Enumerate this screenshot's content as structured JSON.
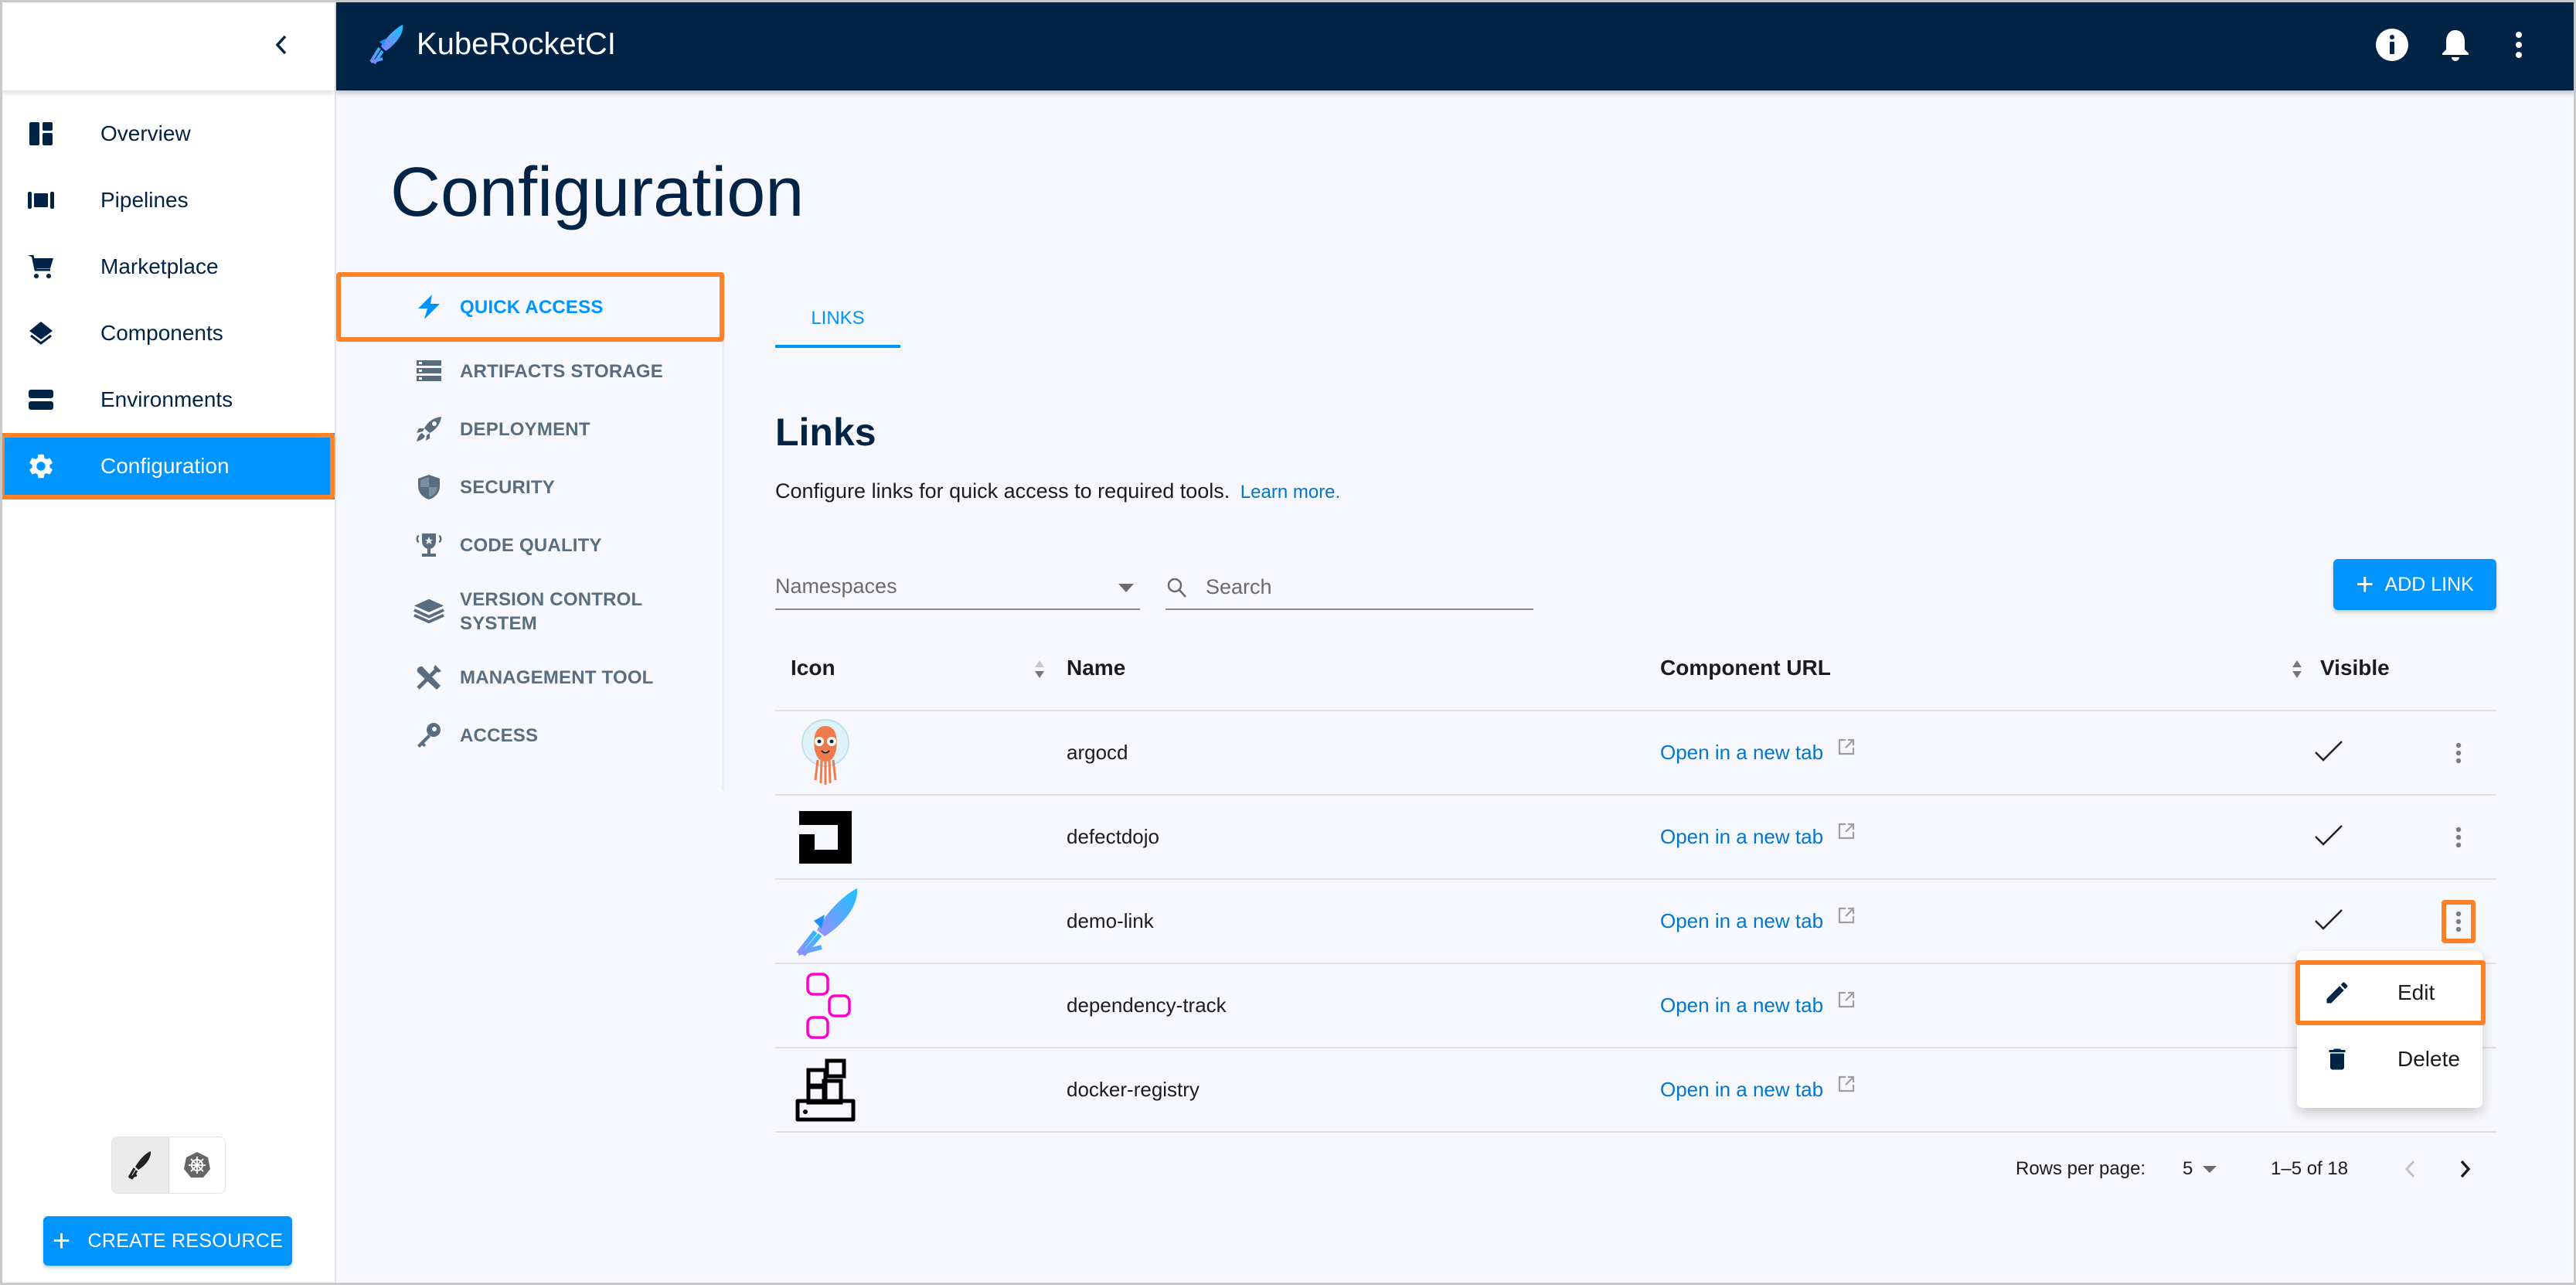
{
  "app": {
    "title": "KubeRocketCI",
    "colors": {
      "header_bg": "#002346",
      "accent": "#0094ff",
      "highlight": "#ff8128",
      "link": "#0077cc",
      "text_dark": "#002346",
      "nav_muted": "#596d80"
    }
  },
  "header": {
    "actions": [
      {
        "name": "info-icon",
        "label": "Info"
      },
      {
        "name": "bell-icon",
        "label": "Notifications"
      },
      {
        "name": "more-vertical-icon",
        "label": "More"
      }
    ]
  },
  "sidebar": {
    "collapse_icon": "chevron-left-icon",
    "items": [
      {
        "label": "Overview",
        "icon": "dashboard-icon",
        "active": false
      },
      {
        "label": "Pipelines",
        "icon": "pipelines-icon",
        "active": false
      },
      {
        "label": "Marketplace",
        "icon": "cart-icon",
        "active": false
      },
      {
        "label": "Components",
        "icon": "layers-icon",
        "active": false
      },
      {
        "label": "Environments",
        "icon": "environments-icon",
        "active": false
      },
      {
        "label": "Configuration",
        "icon": "gear-icon",
        "active": true
      }
    ],
    "mode_toggle": [
      {
        "name": "kuberocketci-mode",
        "icon": "rocket-icon",
        "selected": true
      },
      {
        "name": "kubernetes-mode",
        "icon": "kubernetes-icon",
        "selected": false
      }
    ],
    "create_button": "CREATE RESOURCE"
  },
  "page": {
    "title": "Configuration"
  },
  "config_nav": {
    "items": [
      {
        "label": "QUICK ACCESS",
        "icon": "bolt-icon",
        "active": true
      },
      {
        "label": "ARTIFACTS STORAGE",
        "icon": "storage-icon",
        "active": false
      },
      {
        "label": "DEPLOYMENT",
        "icon": "rocket-launch-icon",
        "active": false
      },
      {
        "label": "SECURITY",
        "icon": "shield-icon",
        "active": false
      },
      {
        "label": "CODE QUALITY",
        "icon": "trophy-icon",
        "active": false
      },
      {
        "label": "VERSION CONTROL SYSTEM",
        "label_line1": "VERSION CONTROL",
        "label_line2": "SYSTEM",
        "icon": "stack-icon",
        "active": false
      },
      {
        "label": "MANAGEMENT TOOL",
        "icon": "tools-icon",
        "active": false
      },
      {
        "label": "ACCESS",
        "icon": "key-icon",
        "active": false
      }
    ]
  },
  "tabs": [
    {
      "label": "LINKS",
      "active": true
    }
  ],
  "links": {
    "title": "Links",
    "description": "Configure links for quick access to required tools.",
    "learn_more": "Learn more.",
    "namespaces_placeholder": "Namespaces",
    "search_placeholder": "Search",
    "add_button": "ADD LINK",
    "columns": [
      "Icon",
      "Name",
      "Component URL",
      "Visible"
    ],
    "rows": [
      {
        "name": "argocd",
        "icon": "argocd-logo",
        "url_label": "Open in a new tab",
        "visible": true
      },
      {
        "name": "defectdojo",
        "icon": "defectdojo-logo",
        "url_label": "Open in a new tab",
        "visible": true
      },
      {
        "name": "demo-link",
        "icon": "kuberocketci-logo",
        "url_label": "Open in a new tab",
        "visible": true
      },
      {
        "name": "dependency-track",
        "icon": "dependency-track-logo",
        "url_label": "Open in a new tab",
        "visible": null
      },
      {
        "name": "docker-registry",
        "icon": "docker-registry-logo",
        "url_label": "Open in a new tab",
        "visible": null
      }
    ],
    "pagination": {
      "rows_per_page_label": "Rows per page:",
      "rows_per_page": "5",
      "range": "1–5 of 18"
    },
    "row_menu": {
      "row": "demo-link",
      "items": [
        {
          "label": "Edit",
          "icon": "pencil-icon"
        },
        {
          "label": "Delete",
          "icon": "trash-icon"
        }
      ]
    }
  }
}
